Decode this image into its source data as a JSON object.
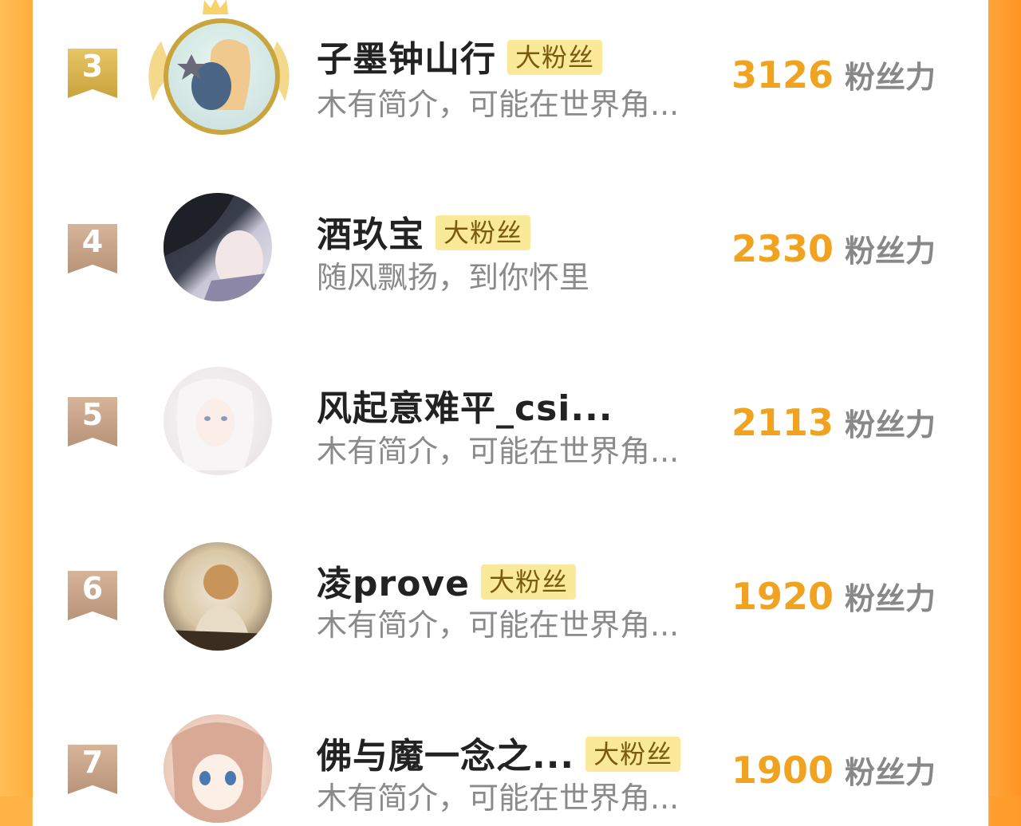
{
  "unit_label": "粉丝力",
  "tag_label": "大粉丝",
  "colors": {
    "accent_orange": "#f0a320",
    "gold_badge": "#c9a33c",
    "bronze_badge": "#b89478",
    "tag_bg": "#fbe99a"
  },
  "rows": [
    {
      "rank": "3",
      "name": "子墨钟山行",
      "tag": "大粉丝",
      "bio": "木有简介，可能在世界角...",
      "score": "3126",
      "unit": "粉丝力"
    },
    {
      "rank": "4",
      "name": "酒玖宝",
      "tag": "大粉丝",
      "bio": "随风飘扬，到你怀里",
      "score": "2330",
      "unit": "粉丝力"
    },
    {
      "rank": "5",
      "name": "风起意难平_csi...",
      "tag": "",
      "bio": "木有简介，可能在世界角...",
      "score": "2113",
      "unit": "粉丝力"
    },
    {
      "rank": "6",
      "name": "凌prove",
      "tag": "大粉丝",
      "bio": "木有简介，可能在世界角...",
      "score": "1920",
      "unit": "粉丝力"
    },
    {
      "rank": "7",
      "name": "佛与魔一念之...",
      "tag": "大粉丝",
      "bio": "木有简介，可能在世界角...",
      "score": "1900",
      "unit": "粉丝力"
    }
  ]
}
